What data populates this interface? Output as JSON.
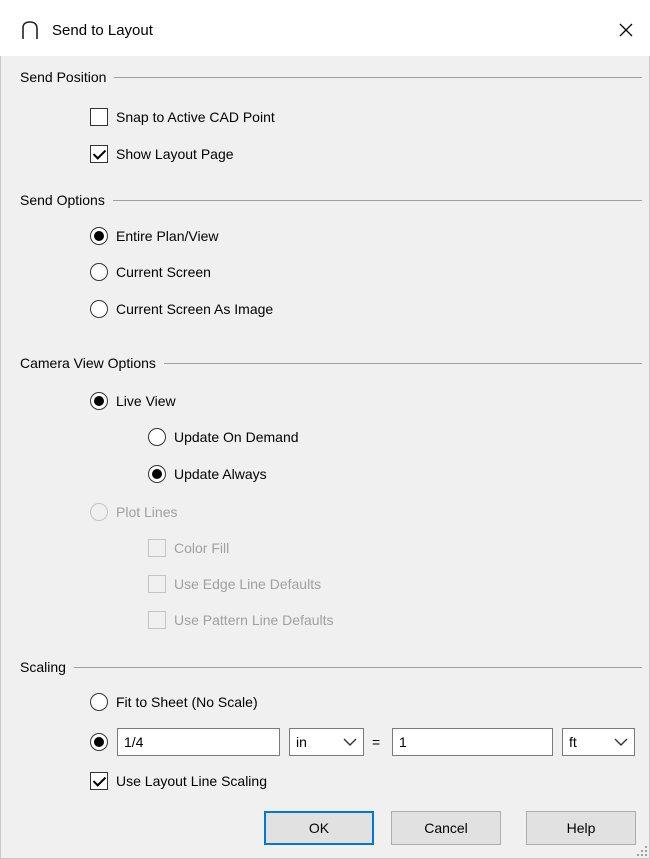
{
  "window": {
    "title": "Send to Layout",
    "icon": "arch-icon",
    "close_icon": "close-icon"
  },
  "send_position": {
    "heading": "Send Position",
    "snap_to_cad_point": {
      "label": "Snap to Active CAD Point",
      "checked": false
    },
    "show_layout_page": {
      "label": "Show Layout Page",
      "checked": true
    }
  },
  "send_options": {
    "heading": "Send Options",
    "entire_plan": {
      "label": "Entire Plan/View",
      "selected": true
    },
    "current_screen": {
      "label": "Current Screen",
      "selected": false
    },
    "current_screen_image": {
      "label": "Current Screen As Image",
      "selected": false
    }
  },
  "camera_view_options": {
    "heading": "Camera View Options",
    "live_view": {
      "label": "Live View",
      "selected": true
    },
    "update_on_demand": {
      "label": "Update On Demand",
      "selected": false
    },
    "update_always": {
      "label": "Update Always",
      "selected": true
    },
    "plot_lines": {
      "label": "Plot Lines",
      "selected": false,
      "disabled": true
    },
    "color_fill": {
      "label": "Color Fill",
      "checked": false,
      "disabled": true
    },
    "edge_line_defaults": {
      "label": "Use Edge Line Defaults",
      "checked": false,
      "disabled": true
    },
    "pattern_line_defaults": {
      "label": "Use Pattern Line Defaults",
      "checked": false,
      "disabled": true
    }
  },
  "scaling": {
    "heading": "Scaling",
    "fit_to_sheet": {
      "label": "Fit to Sheet (No Scale)",
      "selected": false
    },
    "custom_scale": {
      "selected": true,
      "value": "1/4",
      "unit": "in",
      "equals": "=",
      "target_value": "1",
      "target_unit": "ft"
    },
    "layout_line_scaling": {
      "label": "Use Layout Line Scaling",
      "checked": true
    }
  },
  "buttons": {
    "ok": "OK",
    "cancel": "Cancel",
    "help": "Help"
  },
  "colors": {
    "background": "#f0f0f0",
    "titlebar": "#ffffff",
    "default_button_border": "#0078d7",
    "disabled_text": "#a0a0a0"
  }
}
